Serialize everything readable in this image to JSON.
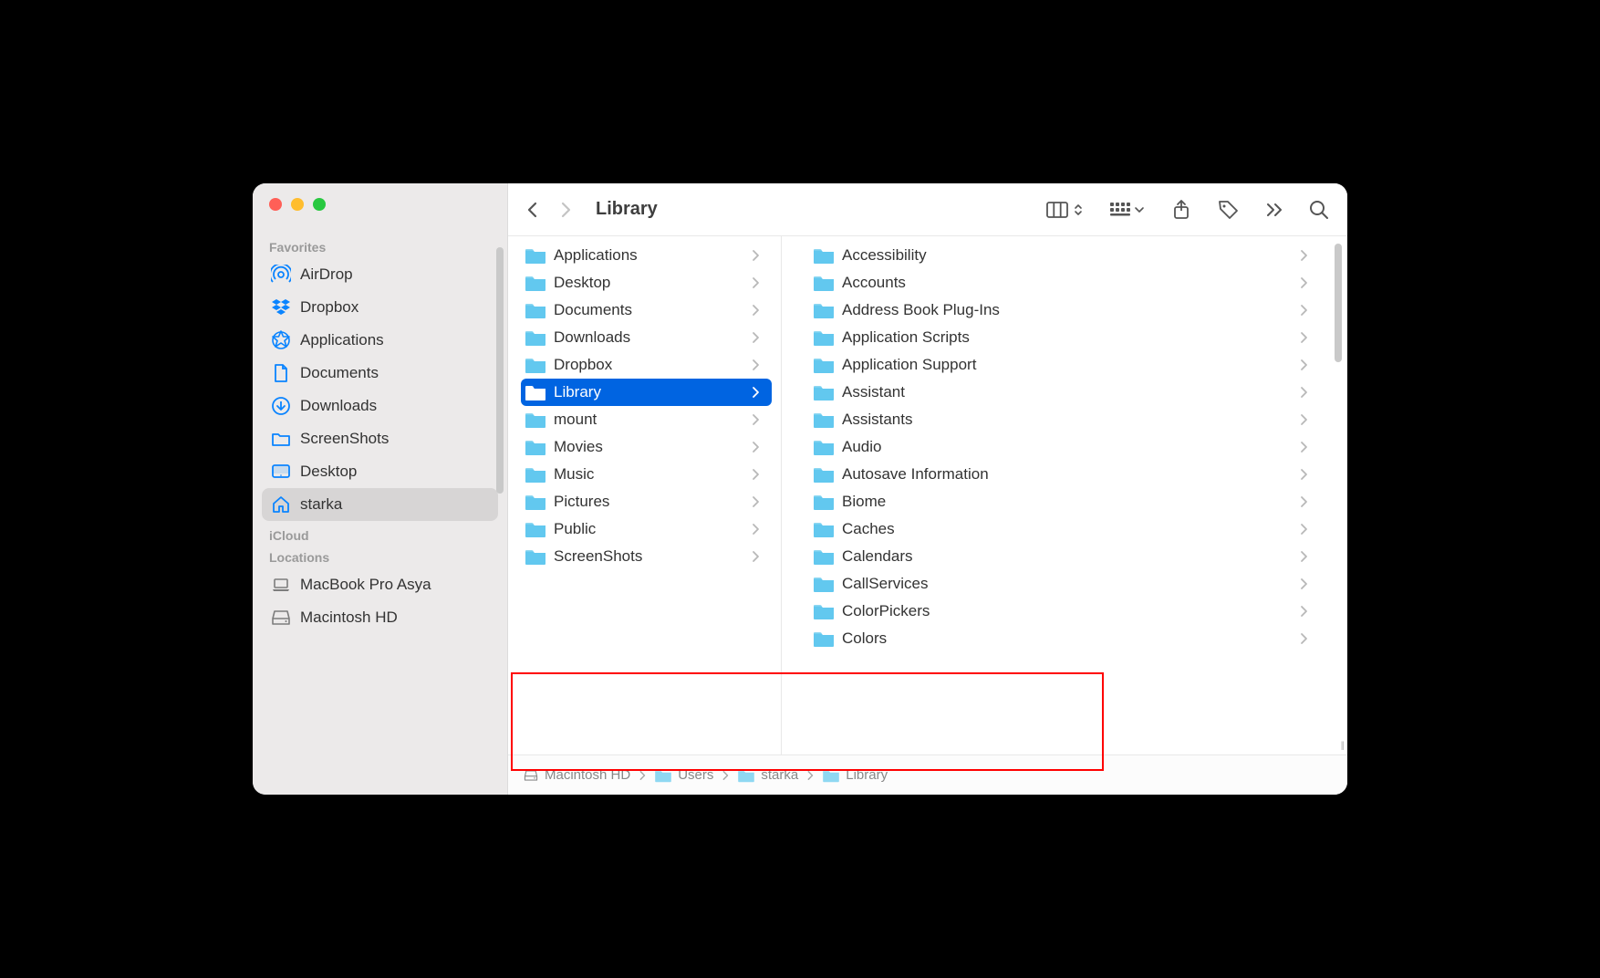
{
  "window": {
    "title": "Library"
  },
  "sidebar": {
    "sections": [
      {
        "label": "Favorites",
        "items": [
          {
            "label": "AirDrop",
            "icon": "airdrop"
          },
          {
            "label": "Dropbox",
            "icon": "dropbox"
          },
          {
            "label": "Applications",
            "icon": "applications"
          },
          {
            "label": "Documents",
            "icon": "document"
          },
          {
            "label": "Downloads",
            "icon": "download"
          },
          {
            "label": "ScreenShots",
            "icon": "folder"
          },
          {
            "label": "Desktop",
            "icon": "desktop"
          },
          {
            "label": "starka",
            "icon": "house",
            "selected": true
          }
        ]
      },
      {
        "label": "iCloud",
        "items": []
      },
      {
        "label": "Locations",
        "items": [
          {
            "label": "MacBook Pro Asya",
            "icon": "laptop",
            "gray": true
          },
          {
            "label": "Macintosh HD",
            "icon": "disk",
            "gray": true
          }
        ]
      }
    ]
  },
  "columns": {
    "left": [
      {
        "label": "Applications",
        "icon": "folder"
      },
      {
        "label": "Desktop",
        "icon": "folder-desktop"
      },
      {
        "label": "Documents",
        "icon": "folder-doc"
      },
      {
        "label": "Downloads",
        "icon": "folder-down"
      },
      {
        "label": "Dropbox",
        "icon": "folder-dropbox"
      },
      {
        "label": "Library",
        "icon": "folder",
        "selected": true
      },
      {
        "label": "mount",
        "icon": "folder"
      },
      {
        "label": "Movies",
        "icon": "folder-movie"
      },
      {
        "label": "Music",
        "icon": "folder-music"
      },
      {
        "label": "Pictures",
        "icon": "folder-pic"
      },
      {
        "label": "Public",
        "icon": "folder-public"
      },
      {
        "label": "ScreenShots",
        "icon": "folder"
      }
    ],
    "right": [
      {
        "label": "Accessibility"
      },
      {
        "label": "Accounts"
      },
      {
        "label": "Address Book Plug-Ins"
      },
      {
        "label": "Application Scripts"
      },
      {
        "label": "Application Support"
      },
      {
        "label": "Assistant"
      },
      {
        "label": "Assistants"
      },
      {
        "label": "Audio"
      },
      {
        "label": "Autosave Information"
      },
      {
        "label": "Biome"
      },
      {
        "label": "Caches"
      },
      {
        "label": "Calendars"
      },
      {
        "label": "CallServices"
      },
      {
        "label": "ColorPickers"
      },
      {
        "label": "Colors"
      }
    ]
  },
  "pathbar": [
    {
      "label": "Macintosh HD",
      "icon": "disk"
    },
    {
      "label": "Users",
      "icon": "folder"
    },
    {
      "label": "starka",
      "icon": "folder-home"
    },
    {
      "label": "Library",
      "icon": "folder"
    }
  ]
}
